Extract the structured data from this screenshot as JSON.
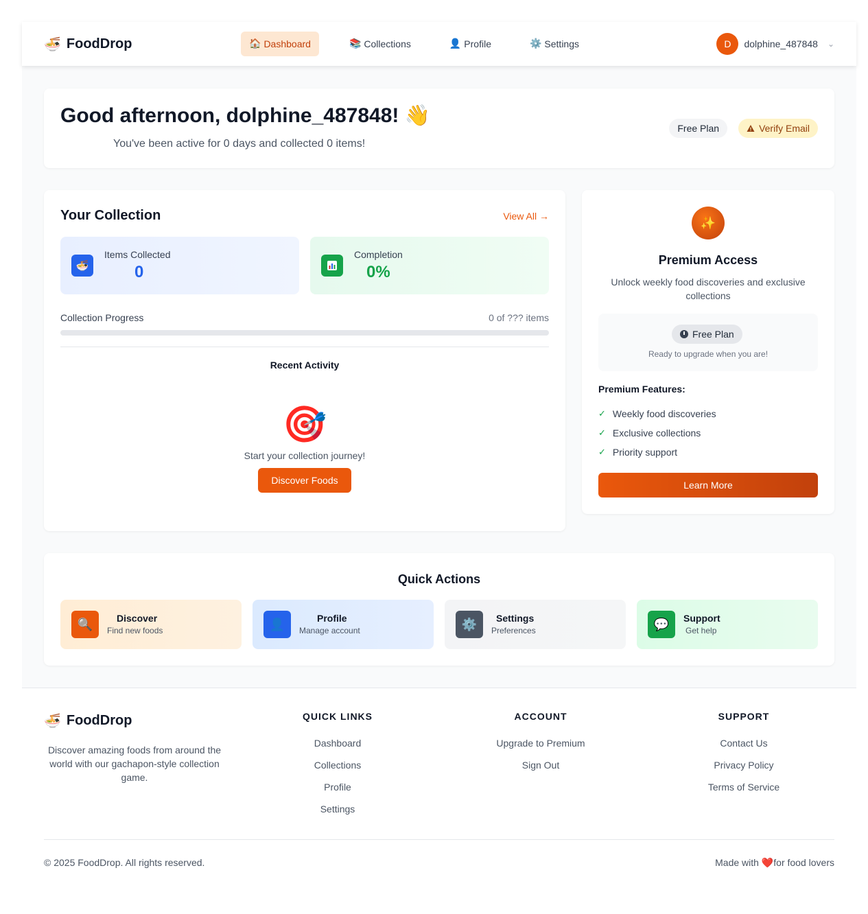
{
  "app": {
    "brand": "FoodDrop",
    "brand_icon": "🍜"
  },
  "nav": {
    "items": [
      {
        "icon": "🏠",
        "label": "Dashboard",
        "active": true
      },
      {
        "icon": "📚",
        "label": "Collections",
        "active": false
      },
      {
        "icon": "👤",
        "label": "Profile",
        "active": false
      },
      {
        "icon": "⚙️",
        "label": "Settings",
        "active": false
      }
    ],
    "user": {
      "initial": "D",
      "name": "dolphine_487848"
    }
  },
  "greeting": {
    "title": "Good afternoon, dolphine_487848!",
    "wave": "👋",
    "subtitle": "You've been active for 0 days and collected 0 items!",
    "plan_badge": "Free Plan",
    "verify_badge": "Verify Email"
  },
  "collection": {
    "title": "Your Collection",
    "view_all": "View All →",
    "items_collected_label": "Items Collected",
    "items_collected_value": "0",
    "completion_label": "Completion",
    "completion_value": "0%",
    "progress_label": "Collection Progress",
    "progress_count": "0 of ??? items",
    "progress_fraction": 0,
    "recent_activity": "Recent Activity",
    "empty_icon": "🎯",
    "empty_text": "Start your collection journey!",
    "discover_button": "Discover Foods"
  },
  "premium": {
    "icon": "✨",
    "title": "Premium Access",
    "description": "Unlock weekly food discoveries and exclusive collections",
    "plan_pill": "Free Plan",
    "ready_text": "Ready to upgrade when you are!",
    "features_title": "Premium Features:",
    "features": [
      "Weekly food discoveries",
      "Exclusive collections",
      "Priority support"
    ],
    "learn_more": "Learn More"
  },
  "quick_actions": {
    "title": "Quick Actions",
    "tiles": [
      {
        "icon": "🔍",
        "title": "Discover",
        "subtitle": "Find new foods"
      },
      {
        "icon": "👤",
        "title": "Profile",
        "subtitle": "Manage account"
      },
      {
        "icon": "⚙️",
        "title": "Settings",
        "subtitle": "Preferences"
      },
      {
        "icon": "💬",
        "title": "Support",
        "subtitle": "Get help"
      }
    ]
  },
  "footer": {
    "brand": "FoodDrop",
    "description": "Discover amazing foods from around the world with our gachapon-style collection game.",
    "columns": [
      {
        "title": "QUICK LINKS",
        "links": [
          "Dashboard",
          "Collections",
          "Profile",
          "Settings"
        ]
      },
      {
        "title": "ACCOUNT",
        "links": [
          "Upgrade to Premium",
          "Sign Out"
        ]
      },
      {
        "title": "SUPPORT",
        "links": [
          "Contact Us",
          "Privacy Policy",
          "Terms of Service"
        ]
      }
    ],
    "copyright": "© 2025 FoodDrop. All rights reserved.",
    "made_with_prefix": "Made with ",
    "heart": "❤️",
    "made_with_suffix": "for food lovers"
  }
}
